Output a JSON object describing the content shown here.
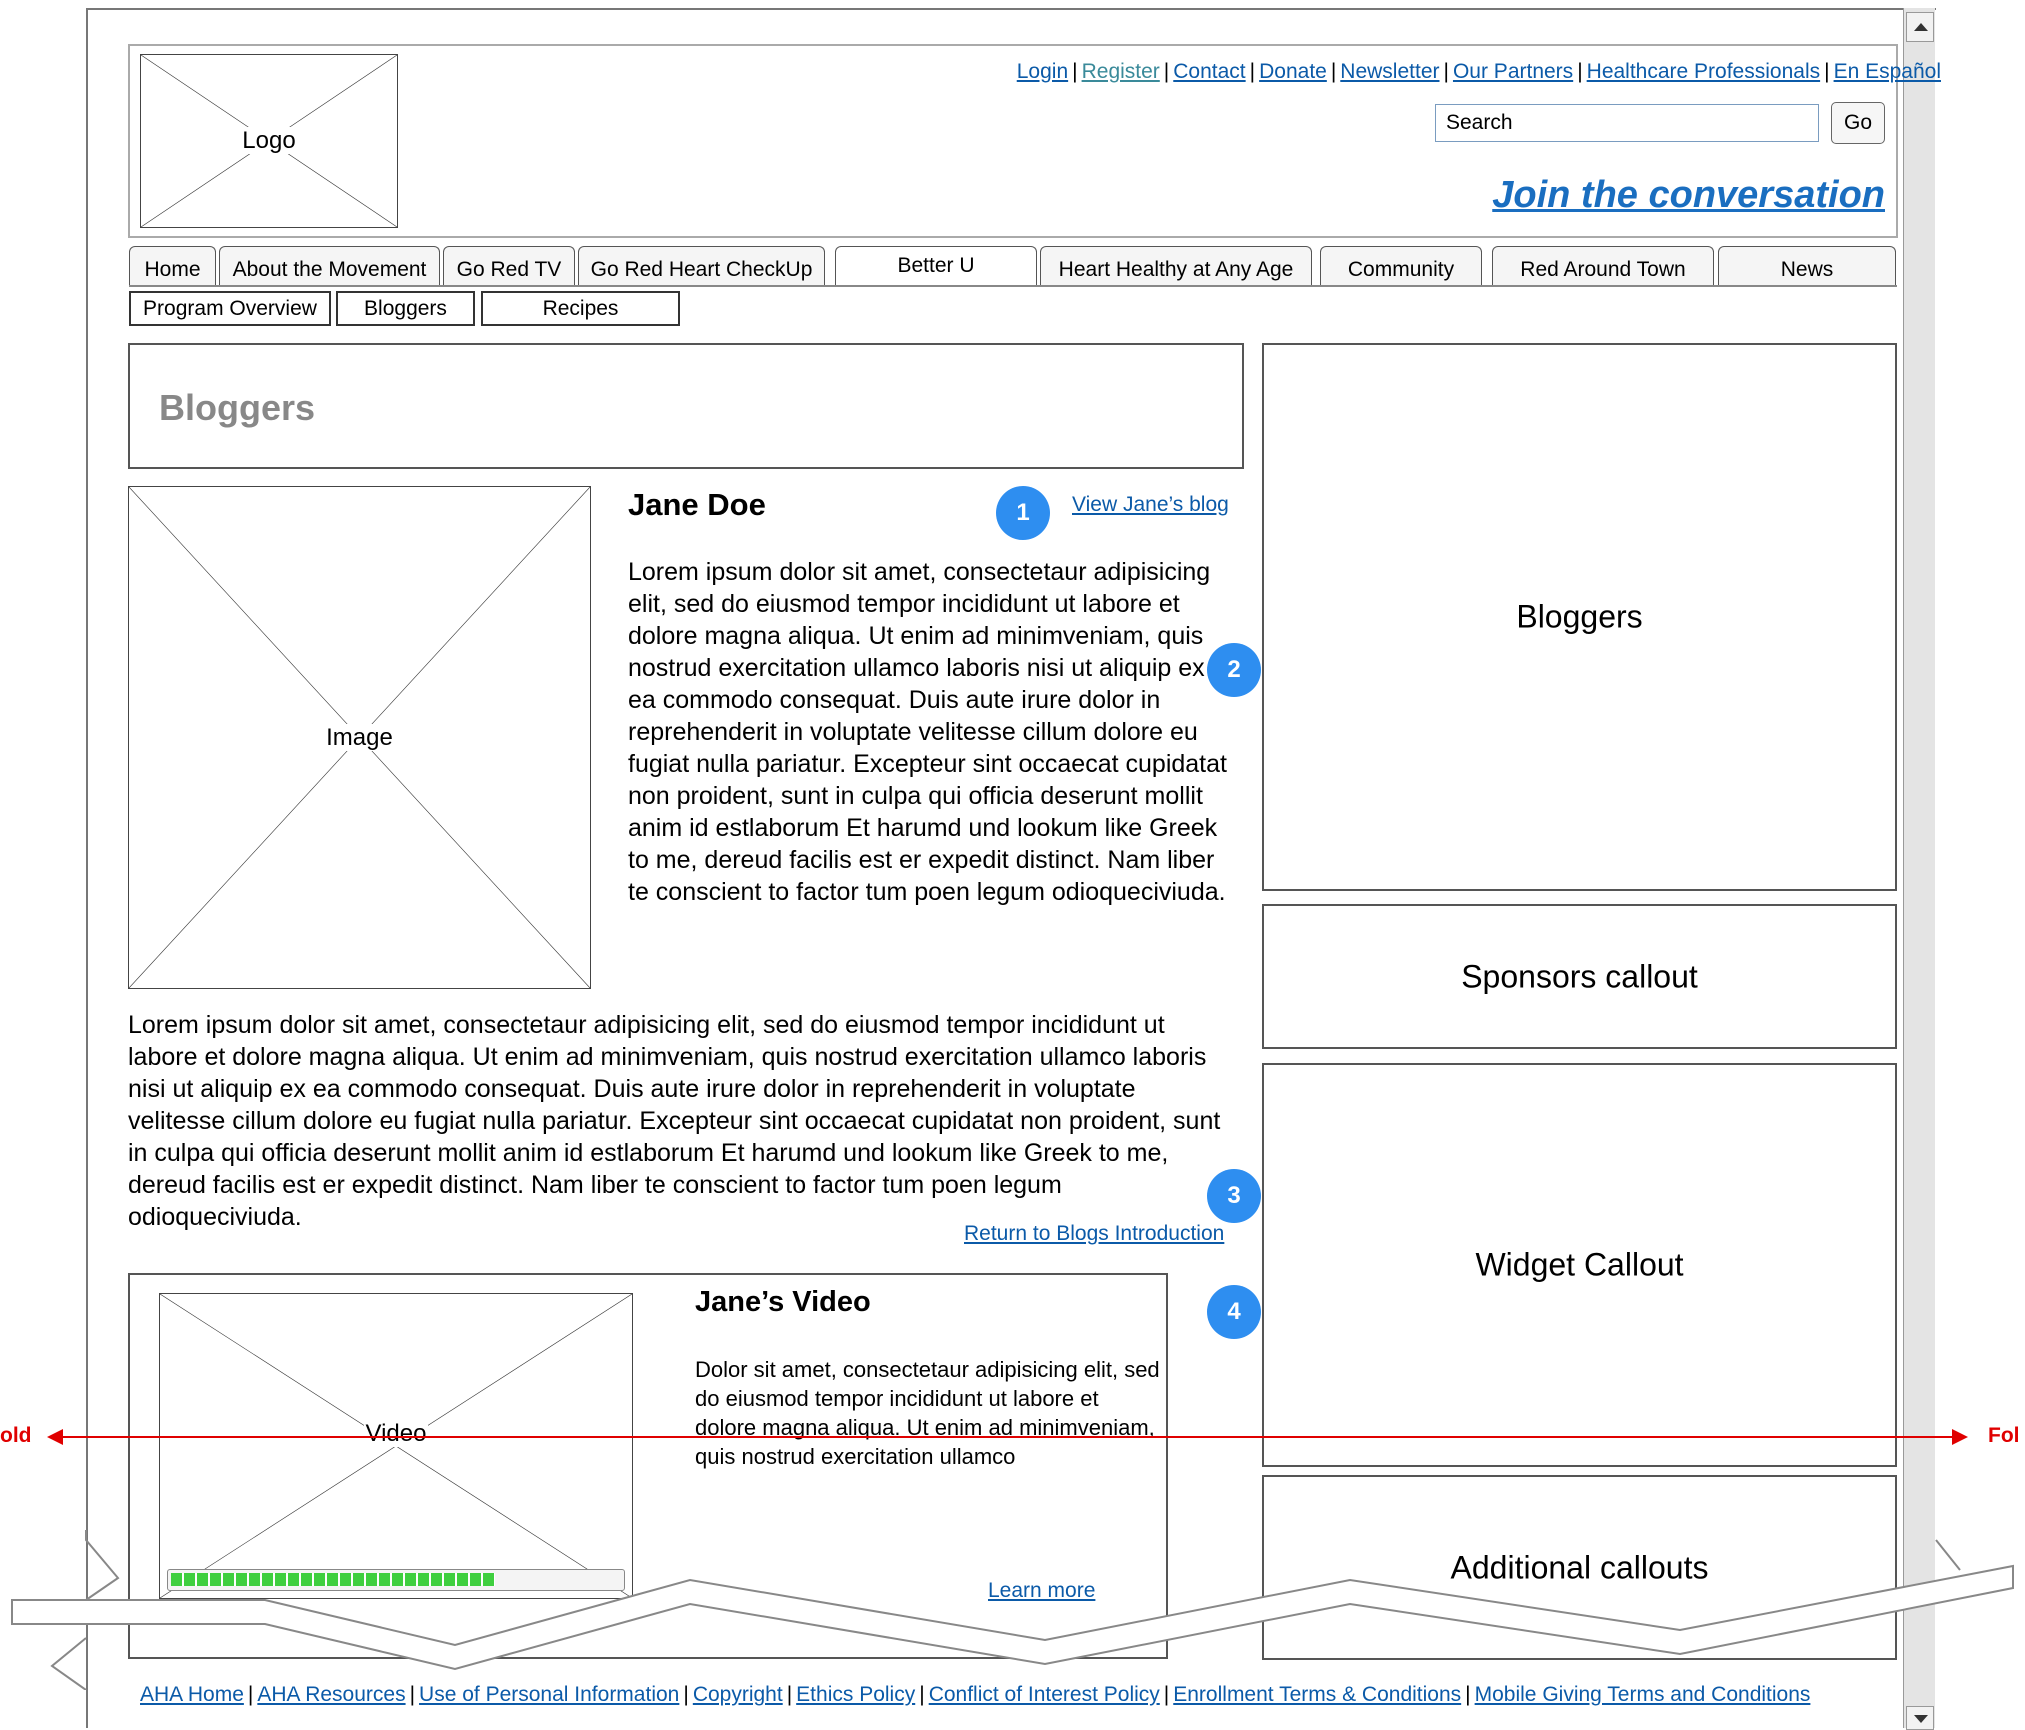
{
  "header": {
    "logo_label": "Logo",
    "top_links": [
      "Login",
      "Register",
      "Contact",
      "Donate",
      "Newsletter",
      "Our Partners",
      "Healthcare Professionals",
      "En Español"
    ],
    "search": {
      "value": "Search",
      "button": "Go"
    },
    "join_label": "Join the conversation"
  },
  "nav": {
    "tabs": [
      "Home",
      "About the Movement",
      "Go Red TV",
      "Go Red Heart CheckUp",
      "Better U",
      "Heart Healthy at Any Age",
      "Community",
      "Red Around Town",
      "News"
    ],
    "active_tab": "Better U",
    "subtabs": [
      "Program Overview",
      "Bloggers",
      "Recipes"
    ]
  },
  "main": {
    "page_title": "Bloggers",
    "profile": {
      "image_label": "Image",
      "name": "Jane Doe",
      "blog_link": "View Jane’s blog",
      "bio": "Lorem ipsum dolor sit amet, consectetaur adipisicing elit, sed do eiusmod tempor incididunt ut labore et dolore magna aliqua. Ut enim ad minimveniam, quis nostrud exercitation ullamco laboris nisi ut aliquip ex ea commodo consequat. Duis aute irure dolor in reprehenderit in voluptate velitesse cillum dolore eu fugiat nulla pariatur. Excepteur sint occaecat cupidatat non proident, sunt in culpa qui officia deserunt mollit anim id estlaborum Et harumd und lookum like Greek to me, dereud facilis est er expedit distinct. Nam liber te conscient to factor tum poen legum odioqueciviuda."
    },
    "body_paragraph": "Lorem ipsum dolor sit amet, consectetaur adipisicing elit, sed do eiusmod tempor incididunt ut labore et dolore magna aliqua. Ut enim ad minimveniam, quis nostrud exercitation ullamco laboris nisi ut aliquip ex ea commodo consequat. Duis aute irure dolor in reprehenderit in voluptate velitesse cillum dolore eu fugiat nulla pariatur. Excepteur sint occaecat cupidatat non proident, sunt in culpa qui officia deserunt mollit anim id estlaborum Et harumd und lookum like Greek to me, dereud facilis est er expedit distinct. Nam liber te conscient to factor tum poen legum odioqueciviuda.",
    "return_link": "Return to Blogs Introduction",
    "video": {
      "label": "Video",
      "title": "Jane’s Video",
      "text": "Dolor sit amet, consectetaur adipisicing elit, sed do eiusmod tempor incididunt ut labore et dolore magna aliqua. Ut enim ad minimveniam, quis nostrud exercitation ullamco",
      "learn_more": "Learn more",
      "progress": 0.72
    },
    "badges": [
      "1",
      "2",
      "3",
      "4"
    ]
  },
  "sidebar": {
    "bloggers": "Bloggers",
    "sponsors": "Sponsors callout",
    "widget": "Widget Callout",
    "additional": "Additional callouts"
  },
  "fold": {
    "left": "old",
    "right": "Fol",
    "color": "#e00000"
  },
  "footer": {
    "links": [
      "AHA Home",
      "AHA Resources",
      "Use of Personal Information",
      "Copyright",
      "Ethics Policy",
      "Conflict of Interest Policy",
      "Enrollment Terms & Conditions",
      "Mobile Giving Terms and Conditions"
    ]
  },
  "colors": {
    "link": "#0b5aa8",
    "badge": "#2e8ef0",
    "progress": "#3fcf3f"
  }
}
